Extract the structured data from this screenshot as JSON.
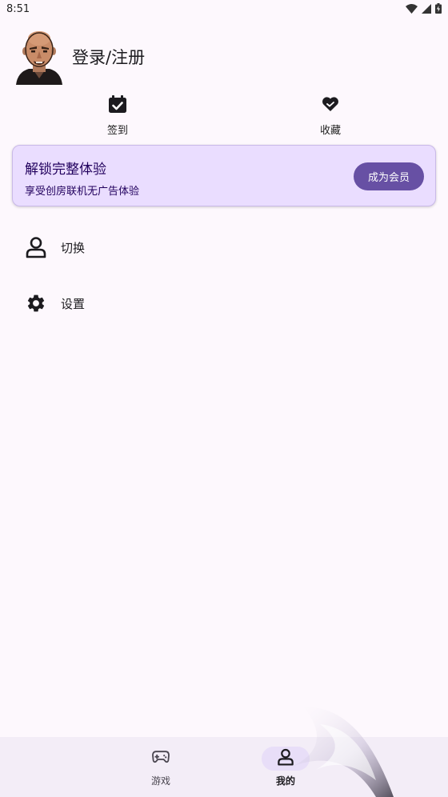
{
  "status_bar": {
    "time": "8:51",
    "icons": [
      "wifi-icon",
      "signal-icon",
      "battery-icon"
    ]
  },
  "profile": {
    "login_label": "登录/注册"
  },
  "quick_actions": {
    "checkin": {
      "label": "签到",
      "icon": "calendar-check-icon"
    },
    "favorite": {
      "label": "收藏",
      "icon": "heart-icon"
    }
  },
  "vip": {
    "title": "解锁完整体验",
    "subtitle": "享受创房联机无广告体验",
    "button_label": "成为会员"
  },
  "menu": {
    "items": [
      {
        "label": "切换",
        "icon": "person-icon"
      },
      {
        "label": "设置",
        "icon": "gear-icon"
      }
    ]
  },
  "bottom_nav": {
    "items": [
      {
        "label": "游戏",
        "icon": "gamepad-icon",
        "selected": false
      },
      {
        "label": "我的",
        "icon": "person-icon",
        "selected": true
      }
    ]
  },
  "colors": {
    "background": "#fdf8fd",
    "primary": "#6750a4",
    "banner_bg": "#eaddff",
    "nav_bg": "#f3edf7",
    "nav_indicator": "#e8def8"
  }
}
